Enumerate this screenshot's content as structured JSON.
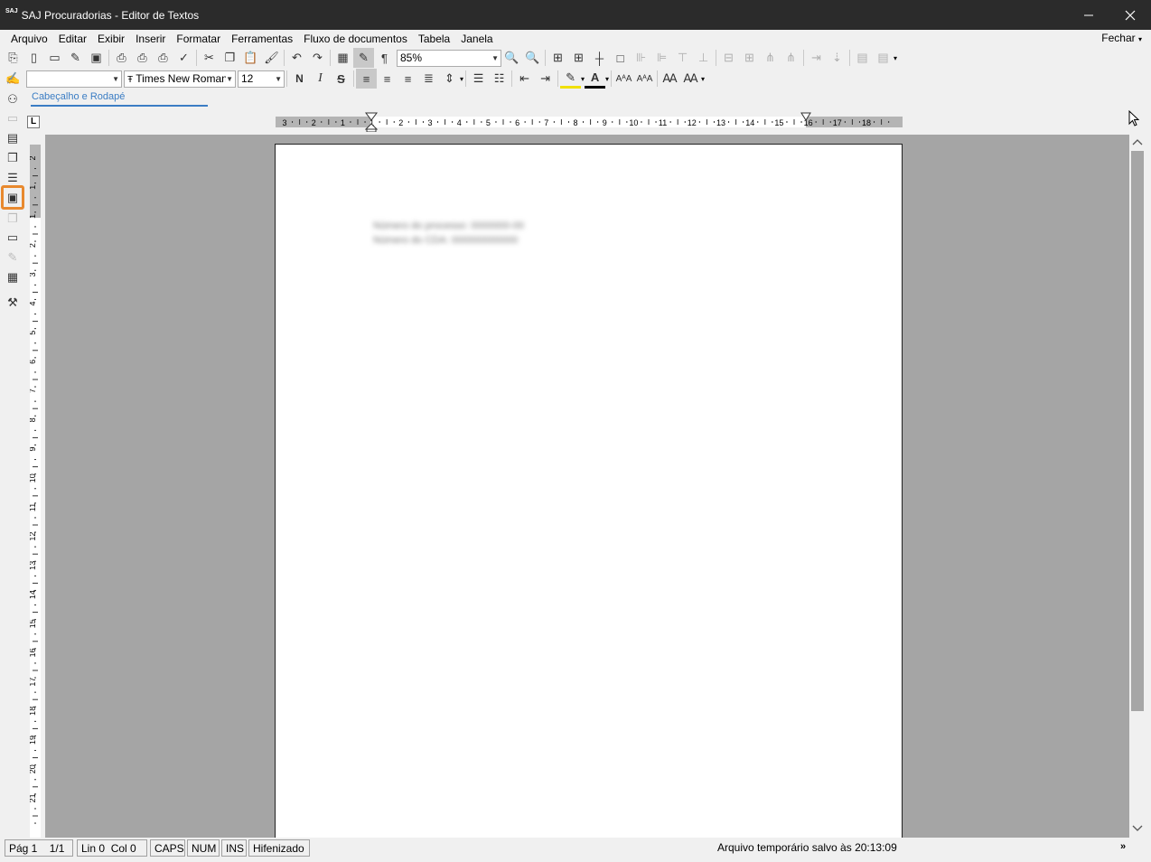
{
  "window": {
    "logo": "SAJ",
    "title": "SAJ Procuradorias - Editor de Textos"
  },
  "menu": {
    "items": [
      "Arquivo",
      "Editar",
      "Exibir",
      "Inserir",
      "Formatar",
      "Ferramentas",
      "Fluxo de documentos",
      "Tabela",
      "Janela"
    ],
    "close": "Fechar"
  },
  "toolbar": {
    "zoom": "85%",
    "style": "",
    "font": "Times New Roman",
    "size": "12",
    "bold": "N",
    "italic": "I",
    "strike": "S"
  },
  "header_panel": {
    "label": "Cabeçalho e Rodapé"
  },
  "ruler": {
    "h_labels": [
      "3",
      "2",
      "1",
      "1",
      "2",
      "3",
      "4",
      "5",
      "6",
      "7",
      "8",
      "9",
      "10",
      "11",
      "12",
      "13",
      "14",
      "15",
      "16",
      "17",
      "18"
    ],
    "v_labels": [
      "2",
      "1",
      "1",
      "2",
      "3",
      "4",
      "5",
      "6",
      "7",
      "8",
      "9",
      "10",
      "11",
      "12",
      "13",
      "14",
      "15",
      "16",
      "17",
      "18",
      "19",
      "20",
      "21"
    ]
  },
  "document": {
    "lines": [
      "Número do processo: 0000000-00",
      "Número do CDA: 000000000000"
    ]
  },
  "status": {
    "page": "Pág 1",
    "pages": "1/1",
    "line": "Lin 0",
    "col": "Col 0",
    "caps": "CAPS",
    "num": "NUM",
    "ins": "INS",
    "hyphen": "Hifenizado",
    "message": "Arquivo temporário salvo às 20:13:09"
  },
  "colors": {
    "titlebar": "#2b2b2b",
    "accent": "#3b7dc4",
    "highlight": "#e8892e",
    "canvas": "#a5a5a5"
  }
}
